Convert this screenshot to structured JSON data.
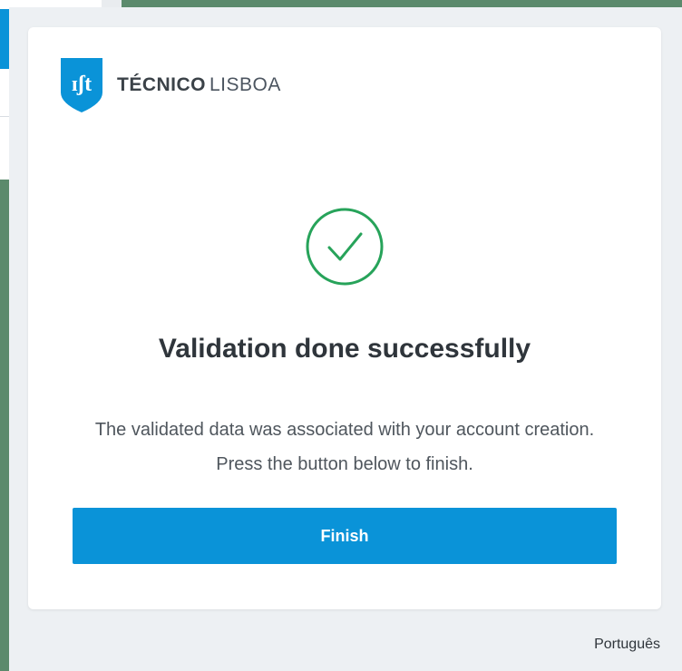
{
  "brand": {
    "name_bold": "TÉCNICO",
    "name_light": "LISBOA",
    "logo_mark": "ɪʃt",
    "color": "#0a93d8"
  },
  "status": {
    "icon": "check-circle-icon",
    "color": "#27a35a"
  },
  "title": "Validation done successfully",
  "message": "The validated data was associated with your account creation. Press the button below to finish.",
  "finish_button": {
    "label": "Finish",
    "color": "#0a93d8"
  },
  "footer": {
    "language": "Português"
  }
}
